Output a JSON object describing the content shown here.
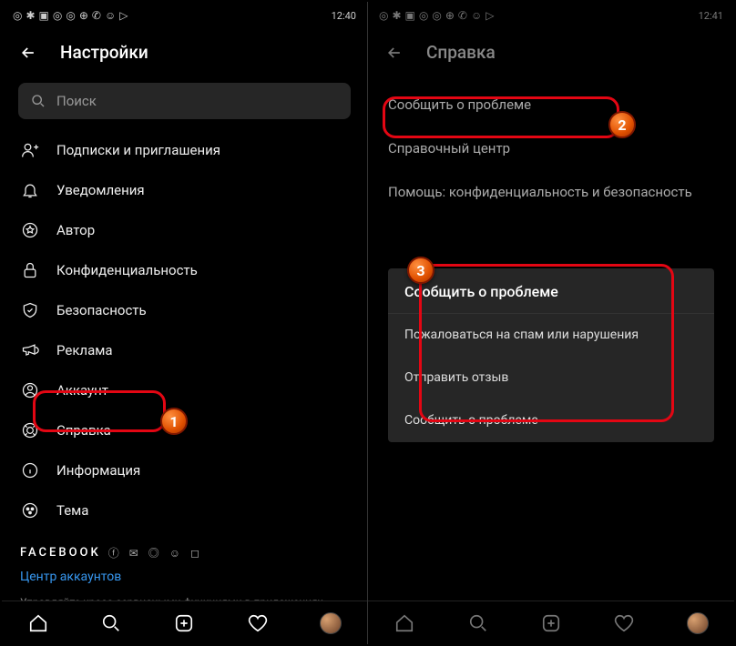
{
  "left": {
    "time": "12:40",
    "title": "Настройки",
    "search_placeholder": "Поиск",
    "items": [
      {
        "label": "Подписки и приглашения"
      },
      {
        "label": "Уведомления"
      },
      {
        "label": "Автор"
      },
      {
        "label": "Конфиденциальность"
      },
      {
        "label": "Безопасность"
      },
      {
        "label": "Реклама"
      },
      {
        "label": "Аккаунт"
      },
      {
        "label": "Справка"
      },
      {
        "label": "Информация"
      },
      {
        "label": "Тема"
      }
    ],
    "section_label": "FACEBOOK",
    "link": "Центр аккаунтов",
    "desc": "Управляйте кросс-сервисными функциями в приложениях Instagram, Facebook и Messenger, например входом в аккаунт и"
  },
  "right": {
    "time": "12:41",
    "title": "Справка",
    "items": [
      {
        "label": "Сообщить  о проблеме"
      },
      {
        "label": "Справочный центр"
      },
      {
        "label": "Помощь: конфиденциальность и безопасность"
      }
    ],
    "popup": {
      "title": "Сообщить  о проблеме",
      "items": [
        "Пожаловаться на спам или нарушения",
        "Отправить отзыв",
        "Сообщить о проблеме"
      ]
    }
  },
  "badges": {
    "b1": "1",
    "b2": "2",
    "b3": "3"
  }
}
